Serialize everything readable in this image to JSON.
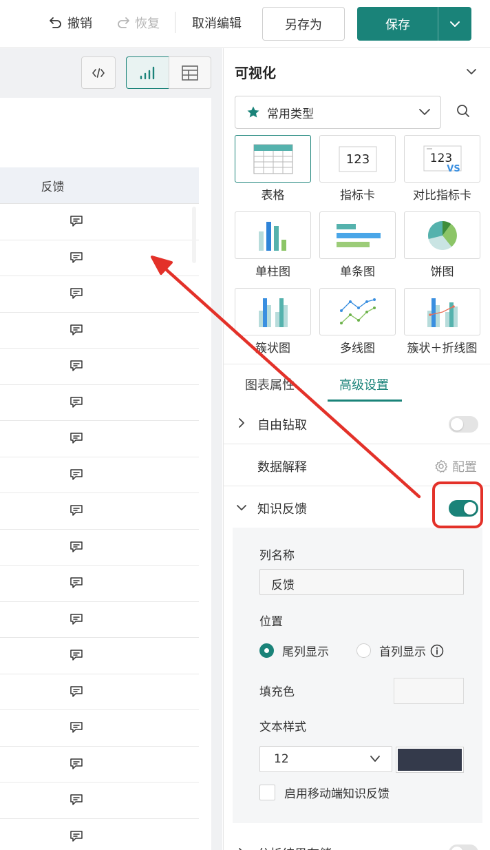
{
  "toolbar": {
    "undo_label": "撤销",
    "redo_label": "恢复",
    "cancel_edit_label": "取消编辑",
    "save_as_label": "另存为",
    "save_label": "保存"
  },
  "table": {
    "column_header": "反馈",
    "row_icon": "comment-icon",
    "row_count": 18
  },
  "panel": {
    "title": "可视化",
    "type_select": {
      "value": "常用类型",
      "icon": "star-icon"
    },
    "chart_types": [
      {
        "label": "表格",
        "icon": "table-chart-icon",
        "selected": true
      },
      {
        "label": "指标卡",
        "icon": "kpi-card-icon",
        "selected": false
      },
      {
        "label": "对比指标卡",
        "icon": "compare-kpi-icon",
        "selected": false
      },
      {
        "label": "单柱图",
        "icon": "column-chart-icon",
        "selected": false
      },
      {
        "label": "单条图",
        "icon": "bar-chart-icon",
        "selected": false
      },
      {
        "label": "饼图",
        "icon": "pie-chart-icon",
        "selected": false
      },
      {
        "label": "簇状图",
        "icon": "clustered-column-icon",
        "selected": false
      },
      {
        "label": "多线图",
        "icon": "multi-line-icon",
        "selected": false
      },
      {
        "label": "簇状＋折线图",
        "icon": "combo-chart-icon",
        "selected": false
      }
    ],
    "kpi_sample": "123",
    "compare_sample": "123",
    "compare_vs": "VS",
    "tabs": [
      {
        "label": "图表属性",
        "active": false
      },
      {
        "label": "高级设置",
        "active": true
      }
    ],
    "settings": {
      "drill_label": "自由钻取",
      "drill_enabled": false,
      "explain_label": "数据解释",
      "config_label": "配置",
      "feedback_label": "知识反馈",
      "feedback_enabled": true
    },
    "feedback_panel": {
      "column_name_label": "列名称",
      "column_name_value": "反馈",
      "position_label": "位置",
      "position_options": [
        {
          "label": "尾列显示",
          "selected": true
        },
        {
          "label": "首列显示",
          "selected": false
        }
      ],
      "fill_color_label": "填充色",
      "text_style_label": "文本样式",
      "font_size": "12",
      "text_color": "#343a4b",
      "mobile_label": "启用移动端知识反馈",
      "mobile_enabled": false
    },
    "bottom_setting_label": "分析结果存储",
    "bottom_setting_enabled": false
  },
  "colors": {
    "accent": "#1a8379",
    "annotation": "#e33129"
  }
}
